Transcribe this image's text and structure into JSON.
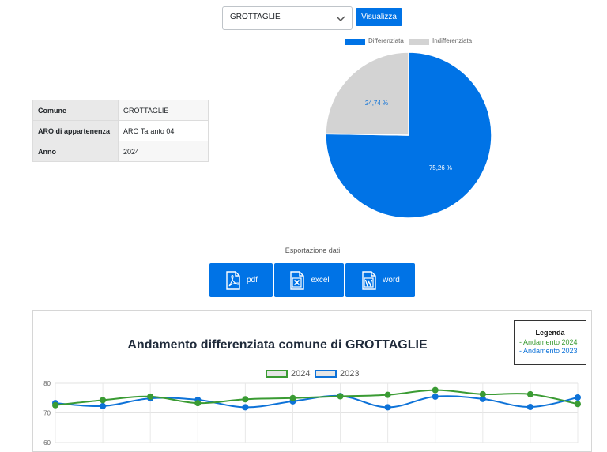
{
  "selector": {
    "value": "GROTTAGLIE",
    "button_label": "Visualizza"
  },
  "info_table": [
    {
      "key": "Comune",
      "value": "GROTTAGLIE"
    },
    {
      "key": "ARO di appartenenza",
      "value": "ARO Taranto 04"
    },
    {
      "key": "Anno",
      "value": "2024"
    }
  ],
  "colors": {
    "accent": "#0073e6",
    "green": "#3a9b33",
    "blue": "#0d72d8",
    "grey": "#d3d3d3"
  },
  "export": {
    "title": "Esportazione dati",
    "buttons": [
      {
        "label": "pdf",
        "icon": "pdf-file-icon"
      },
      {
        "label": "excel",
        "icon": "excel-file-icon"
      },
      {
        "label": "word",
        "icon": "word-file-icon"
      }
    ]
  },
  "line_panel": {
    "title": "Andamento differenziata comune di GROTTAGLIE",
    "legend_box": {
      "title": "Legenda",
      "items": [
        "- Andamento 2024",
        "- Andamento 2023"
      ]
    }
  },
  "chart_data": [
    {
      "type": "pie",
      "legend": [
        "Differenziata",
        "Indifferenziata"
      ],
      "slices": [
        {
          "name": "Differenziata",
          "value": 75.26,
          "label": "75,26 %",
          "color": "#0073e6"
        },
        {
          "name": "Indifferenziata",
          "value": 24.74,
          "label": "24,74 %",
          "color": "#d3d3d3"
        }
      ],
      "legend_position": "top"
    },
    {
      "type": "line",
      "ylim": [
        60,
        80
      ],
      "yticks": [
        60,
        70,
        80
      ],
      "grid": true,
      "legend_position": "top",
      "series": [
        {
          "name": "2024",
          "color": "#3a9b33",
          "values": [
            72.6,
            74.3,
            75.5,
            73.3,
            74.6,
            75.0,
            75.6,
            76.1,
            77.7,
            76.3,
            76.3,
            73.0
          ]
        },
        {
          "name": "2023",
          "color": "#0d72d8",
          "values": [
            73.3,
            72.3,
            74.9,
            74.4,
            71.9,
            73.9,
            75.7,
            71.9,
            75.5,
            74.7,
            72.0,
            75.2
          ]
        }
      ]
    }
  ]
}
